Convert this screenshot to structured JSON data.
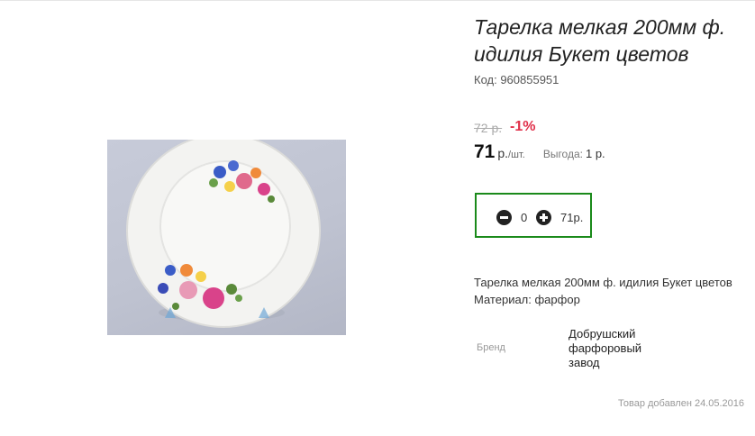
{
  "product": {
    "title": "Тарелка мелкая 200мм ф. идилия Букет цветов",
    "code": "Код: 960855951"
  },
  "pricing": {
    "old_price": "72 р.",
    "discount": "-1%",
    "price": "71",
    "unit_currency": "р.",
    "unit_per": "/шт.",
    "savings_label": "Выгода:",
    "savings_value": "1 р."
  },
  "cart": {
    "quantity": "0",
    "sum": "71р."
  },
  "description": {
    "line1": "Тарелка мелкая 200мм ф. идилия Букет цветов",
    "line2": "Материал: фарфор"
  },
  "specs": {
    "brand_label": "Бренд",
    "brand_value": "Добрушский фарфоровый завод"
  },
  "footer": {
    "added": "Товар добавлен 24.05.2016"
  },
  "colors": {
    "accent_green": "#1a8a1a",
    "discount_red": "#e0304a"
  }
}
